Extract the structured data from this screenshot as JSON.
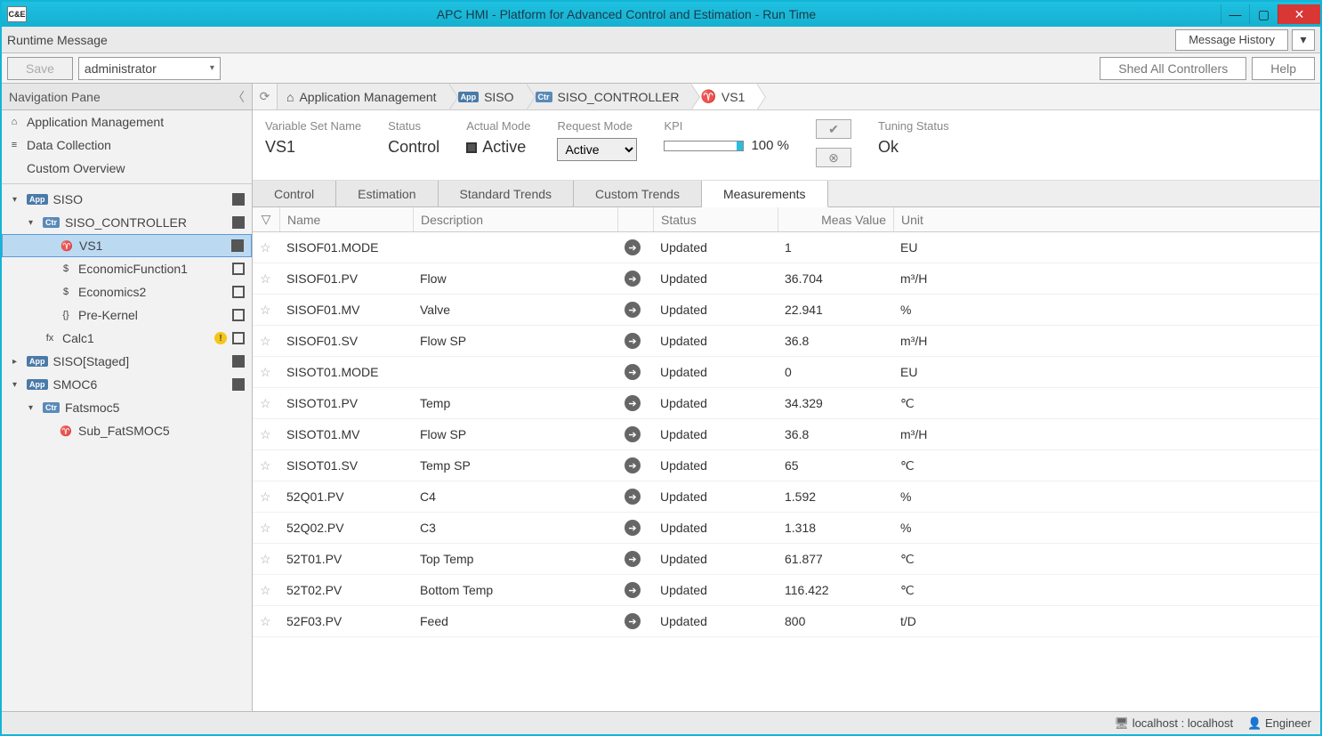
{
  "window": {
    "title": "APC HMI - Platform for Advanced Control and Estimation - Run Time",
    "app_icon": "C&E"
  },
  "message_bar": {
    "label": "Runtime Message",
    "history_btn": "Message History"
  },
  "toolbar": {
    "save": "Save",
    "user": "administrator",
    "shed": "Shed All Controllers",
    "help": "Help"
  },
  "nav": {
    "title": "Navigation Pane",
    "top": [
      {
        "label": "Application Management",
        "icon": "home"
      },
      {
        "label": "Data Collection",
        "icon": "db"
      },
      {
        "label": "Custom Overview",
        "icon": "code"
      }
    ],
    "tree": [
      {
        "indent": 0,
        "expand": "▾",
        "badge": "App",
        "label": "SISO",
        "chk": true
      },
      {
        "indent": 1,
        "expand": "▾",
        "badge": "Ctr",
        "label": "SISO_CONTROLLER",
        "chk": true
      },
      {
        "indent": 2,
        "expand": "",
        "icon": "vs",
        "label": "VS1",
        "chk": true,
        "selected": true
      },
      {
        "indent": 2,
        "expand": "",
        "icon": "ef",
        "label": "EconomicFunction1",
        "chk": true,
        "empty": true
      },
      {
        "indent": 2,
        "expand": "",
        "icon": "ef",
        "label": "Economics2",
        "chk": true,
        "empty": true
      },
      {
        "indent": 2,
        "expand": "",
        "icon": "pk",
        "label": "Pre-Kernel",
        "chk": true,
        "empty": true
      },
      {
        "indent": 1,
        "expand": "",
        "icon": "calc",
        "label": "Calc1",
        "chk": true,
        "warn": true,
        "empty": true
      },
      {
        "indent": 0,
        "expand": "▸",
        "badge": "App",
        "label": "SISO[Staged]",
        "chk": true
      },
      {
        "indent": 0,
        "expand": "▾",
        "badge": "App",
        "label": "SMOC6",
        "chk": true
      },
      {
        "indent": 1,
        "expand": "▾",
        "badge": "Ctr",
        "label": "Fatsmoc5"
      },
      {
        "indent": 2,
        "expand": "",
        "icon": "vs",
        "label": "Sub_FatSMOC5"
      }
    ]
  },
  "breadcrumb": [
    {
      "label": "Application Management",
      "icon": "home"
    },
    {
      "label": "SISO",
      "badge": "App"
    },
    {
      "label": "SISO_CONTROLLER",
      "badge": "Ctr"
    },
    {
      "label": "VS1",
      "icon": "vs",
      "active": true
    }
  ],
  "info": {
    "vsn_label": "Variable Set Name",
    "vsn_value": "VS1",
    "status_label": "Status",
    "status_value": "Control",
    "actual_label": "Actual Mode",
    "actual_value": "Active",
    "request_label": "Request Mode",
    "request_value": "Active",
    "kpi_label": "KPI",
    "kpi_value": "100 %",
    "tuning_label": "Tuning Status",
    "tuning_value": "Ok"
  },
  "tabs": [
    "Control",
    "Estimation",
    "Standard Trends",
    "Custom Trends",
    "Measurements"
  ],
  "active_tab": 4,
  "columns": [
    "Name",
    "Description",
    "Status",
    "Meas Value",
    "Unit"
  ],
  "rows": [
    {
      "name": "SISOF01.MODE",
      "desc": "",
      "status": "Updated",
      "val": "1",
      "unit": "EU"
    },
    {
      "name": "SISOF01.PV",
      "desc": "Flow",
      "status": "Updated",
      "val": "36.704",
      "unit": "m³/H"
    },
    {
      "name": "SISOF01.MV",
      "desc": "Valve",
      "status": "Updated",
      "val": "22.941",
      "unit": "%"
    },
    {
      "name": "SISOF01.SV",
      "desc": "Flow SP",
      "status": "Updated",
      "val": "36.8",
      "unit": "m³/H"
    },
    {
      "name": "SISOT01.MODE",
      "desc": "",
      "status": "Updated",
      "val": "0",
      "unit": "EU"
    },
    {
      "name": "SISOT01.PV",
      "desc": "Temp",
      "status": "Updated",
      "val": "34.329",
      "unit": "℃"
    },
    {
      "name": "SISOT01.MV",
      "desc": "Flow SP",
      "status": "Updated",
      "val": "36.8",
      "unit": "m³/H"
    },
    {
      "name": "SISOT01.SV",
      "desc": "Temp SP",
      "status": "Updated",
      "val": "65",
      "unit": "℃"
    },
    {
      "name": "52Q01.PV",
      "desc": "C4",
      "status": "Updated",
      "val": "1.592",
      "unit": "%"
    },
    {
      "name": "52Q02.PV",
      "desc": "C3",
      "status": "Updated",
      "val": "1.318",
      "unit": "%"
    },
    {
      "name": "52T01.PV",
      "desc": "Top Temp",
      "status": "Updated",
      "val": "61.877",
      "unit": "℃"
    },
    {
      "name": "52T02.PV",
      "desc": "Bottom Temp",
      "status": "Updated",
      "val": "116.422",
      "unit": "℃"
    },
    {
      "name": "52F03.PV",
      "desc": "Feed",
      "status": "Updated",
      "val": "800",
      "unit": "t/D"
    }
  ],
  "statusbar": {
    "host": "localhost : localhost",
    "role": "Engineer"
  }
}
